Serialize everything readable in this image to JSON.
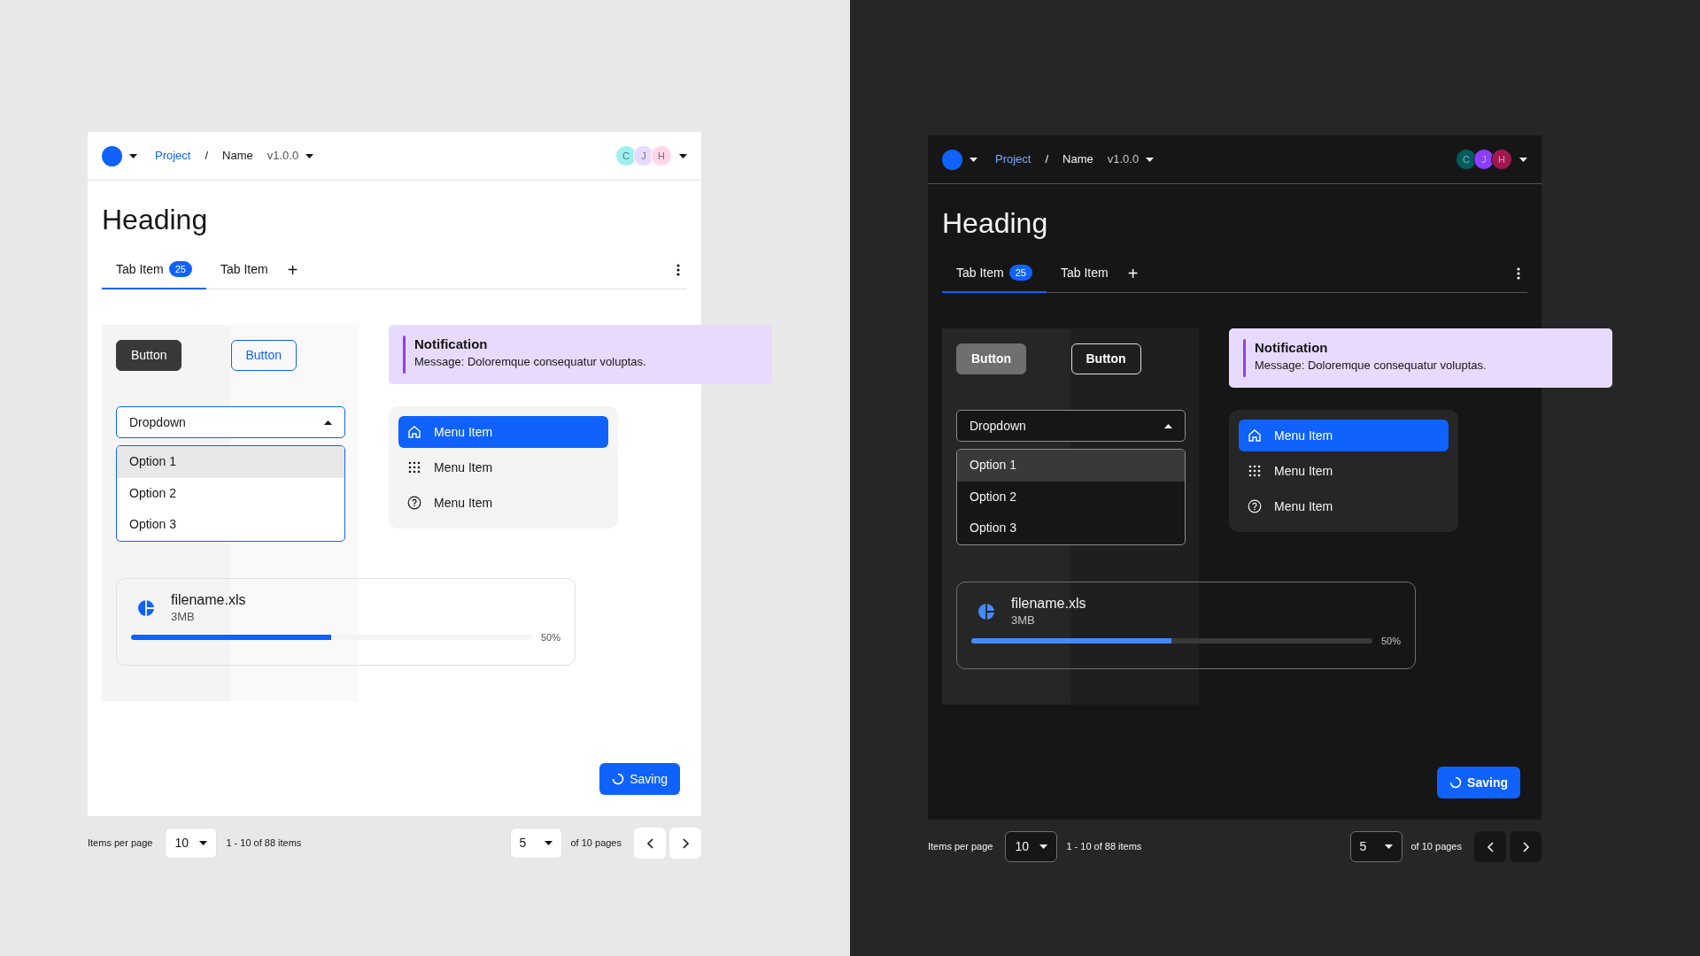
{
  "panels": [
    {
      "kind": "light",
      "header": {
        "breadcrumb": [
          {
            "text": "Project",
            "kind": "link"
          },
          {
            "text": "/",
            "kind": "separator"
          },
          {
            "text": "Name",
            "kind": "plain"
          }
        ],
        "version": "v1.0.0",
        "avatars": [
          {
            "initial": "C",
            "color": "#9ef0f0"
          },
          {
            "initial": "J",
            "color": "#e8daff"
          },
          {
            "initial": "H",
            "color": "#ffd6e8"
          }
        ]
      },
      "heading": "Heading",
      "tabs": [
        {
          "label": "Tab Item",
          "badge": "25",
          "selected": true
        },
        {
          "label": "Tab Item",
          "selected": false
        }
      ],
      "add_tab": "+",
      "buttons": [
        {
          "label": "Button",
          "kind": "filled"
        },
        {
          "label": "Button",
          "kind": "outline"
        }
      ],
      "dropdown": {
        "label": "Dropdown",
        "expanded": true,
        "options": [
          {
            "label": "Option 1",
            "highlighted": true
          },
          {
            "label": "Option 2",
            "highlighted": false
          },
          {
            "label": "Option 3",
            "highlighted": false
          }
        ]
      },
      "notification": {
        "title": "Notification",
        "message": "Message: Doloremque consequatur voluptas."
      },
      "menu": [
        {
          "label": "Menu Item",
          "kind": "home",
          "selected": true
        },
        {
          "label": "Menu Item",
          "kind": "grid",
          "selected": false
        },
        {
          "label": "Menu Item",
          "kind": "help",
          "selected": false
        }
      ],
      "file": {
        "name": "filename.xls",
        "size": "3MB",
        "level": 0.5,
        "reading": "50%"
      },
      "saving_button": "Saving",
      "pagination": {
        "items_label": "Items per page",
        "page_size": "10",
        "range": "1 - 10 of 88 items",
        "page": "5",
        "pages_label": "of 10 pages"
      }
    },
    {
      "kind": "dark",
      "header": {
        "breadcrumb": [
          {
            "text": "Project",
            "kind": "link"
          },
          {
            "text": "/",
            "kind": "separator"
          },
          {
            "text": "Name",
            "kind": "plain"
          }
        ],
        "version": "v1.0.0",
        "avatars": [
          {
            "initial": "C",
            "color": "#005d5d"
          },
          {
            "initial": "J",
            "color": "#8a3ffc"
          },
          {
            "initial": "H",
            "color": "#9f1853"
          }
        ]
      },
      "heading": "Heading",
      "tabs": [
        {
          "label": "Tab Item",
          "badge": "25",
          "selected": true
        },
        {
          "label": "Tab Item",
          "selected": false
        }
      ],
      "add_tab": "+",
      "buttons": [
        {
          "label": "Button",
          "kind": "filled"
        },
        {
          "label": "Button",
          "kind": "outline"
        }
      ],
      "dropdown": {
        "label": "Dropdown",
        "expanded": true,
        "options": [
          {
            "label": "Option 1",
            "highlighted": true
          },
          {
            "label": "Option 2",
            "highlighted": false
          },
          {
            "label": "Option 3",
            "highlighted": false
          }
        ]
      },
      "notification": {
        "title": "Notification",
        "message": "Message: Doloremque consequatur voluptas."
      },
      "menu": [
        {
          "label": "Menu Item",
          "kind": "home",
          "selected": true
        },
        {
          "label": "Menu Item",
          "kind": "grid",
          "selected": false
        },
        {
          "label": "Menu Item",
          "kind": "help",
          "selected": false
        }
      ],
      "file": {
        "name": "filename.xls",
        "size": "3MB",
        "level": 0.5,
        "reading": "50%"
      },
      "saving_button": "Saving",
      "pagination": {
        "items_label": "Items per page",
        "page_size": "10",
        "range": "1 - 10 of 88 items",
        "page": "5",
        "pages_label": "of 10 pages"
      }
    }
  ]
}
